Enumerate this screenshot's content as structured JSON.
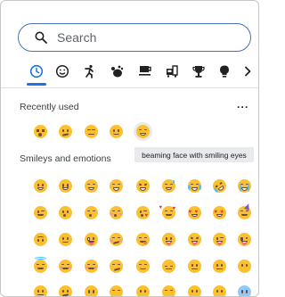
{
  "search": {
    "placeholder": "Search"
  },
  "tabs": [
    {
      "name": "recent-tab",
      "icon": "clock-icon",
      "glyph": "🕒",
      "active": true
    },
    {
      "name": "smileys-tab",
      "icon": "smiley-icon",
      "glyph": "☺",
      "active": false
    },
    {
      "name": "people-tab",
      "icon": "person-running-icon",
      "glyph": "🏃",
      "active": false
    },
    {
      "name": "animals-tab",
      "icon": "animal-icon",
      "glyph": "🐾",
      "active": false
    },
    {
      "name": "food-tab",
      "icon": "coffee-icon",
      "glyph": "☕",
      "active": false
    },
    {
      "name": "travel-tab",
      "icon": "vehicle-icon",
      "glyph": "🚗",
      "active": false
    },
    {
      "name": "activities-tab",
      "icon": "trophy-icon",
      "glyph": "🏆",
      "active": false
    },
    {
      "name": "objects-tab",
      "icon": "lightbulb-icon",
      "glyph": "💡",
      "active": false
    },
    {
      "name": "more-tabs-button",
      "icon": "chevron-right-icon",
      "glyph": "›",
      "active": false
    }
  ],
  "recently_used": {
    "title": "Recently used",
    "more_label": "···"
  },
  "smileys": {
    "title": "Smileys and emotions"
  },
  "tooltip": {
    "text": "beaming face with smiling eyes"
  },
  "accent_color": "#1a73e8",
  "search_border_color": "#4a6fb3"
}
